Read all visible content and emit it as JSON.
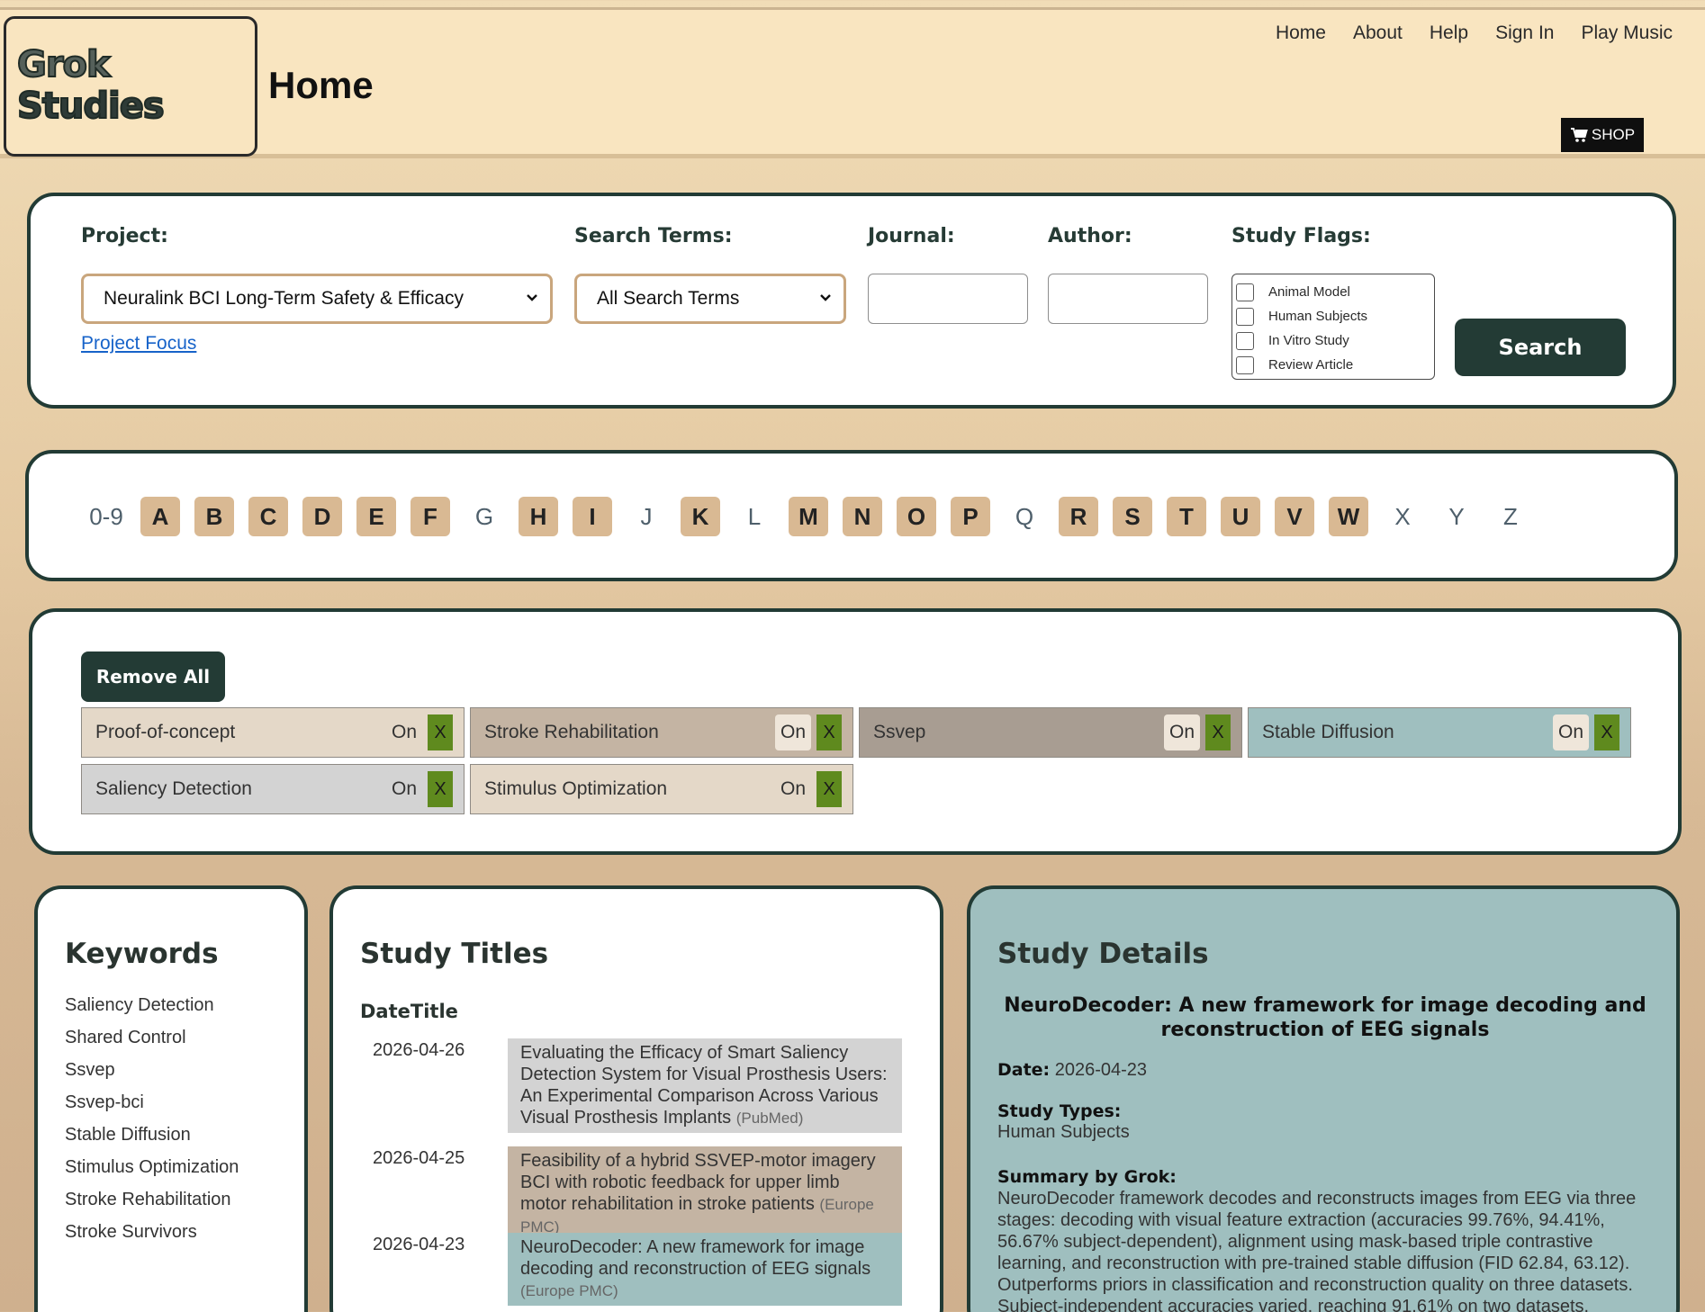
{
  "header": {
    "logo_line1": "Grok",
    "logo_line2": "Studies",
    "title": "Home",
    "nav": [
      "Home",
      "About",
      "Help",
      "Sign In",
      "Play Music"
    ],
    "shop_label": "SHOP"
  },
  "search": {
    "project_label": "Project:",
    "project_value": "Neuralink BCI Long-Term Safety & Efficacy",
    "project_link": "Project Focus",
    "terms_label": "Search Terms:",
    "terms_value": "All Search Terms",
    "journal_label": "Journal:",
    "author_label": "Author:",
    "flags_label": "Study Flags:",
    "flags": [
      "Animal Model",
      "Human Subjects",
      "In Vitro Study",
      "Review Article"
    ],
    "search_button": "Search"
  },
  "alphabet": [
    {
      "l": "0-9",
      "on": false
    },
    {
      "l": "A",
      "on": true
    },
    {
      "l": "B",
      "on": true
    },
    {
      "l": "C",
      "on": true
    },
    {
      "l": "D",
      "on": true
    },
    {
      "l": "E",
      "on": true
    },
    {
      "l": "F",
      "on": true
    },
    {
      "l": "G",
      "on": false
    },
    {
      "l": "H",
      "on": true
    },
    {
      "l": "I",
      "on": true
    },
    {
      "l": "J",
      "on": false
    },
    {
      "l": "K",
      "on": true
    },
    {
      "l": "L",
      "on": false
    },
    {
      "l": "M",
      "on": true
    },
    {
      "l": "N",
      "on": true
    },
    {
      "l": "O",
      "on": true
    },
    {
      "l": "P",
      "on": true
    },
    {
      "l": "Q",
      "on": false
    },
    {
      "l": "R",
      "on": true
    },
    {
      "l": "S",
      "on": true
    },
    {
      "l": "T",
      "on": true
    },
    {
      "l": "U",
      "on": true
    },
    {
      "l": "V",
      "on": true
    },
    {
      "l": "W",
      "on": true
    },
    {
      "l": "X",
      "on": false
    },
    {
      "l": "Y",
      "on": false
    },
    {
      "l": "Z",
      "on": false
    }
  ],
  "filters": {
    "remove_all": "Remove All",
    "on_label": "On",
    "x_label": "X",
    "tags": [
      {
        "label": "Proof-of-concept",
        "color": "#e4d8c8",
        "pill": "#e4d8c8"
      },
      {
        "label": "Stroke Rehabilitation",
        "color": "#c4b4a3",
        "pill": "#efe6da"
      },
      {
        "label": "Ssvep",
        "color": "#a89d92",
        "pill": "#efe6da"
      },
      {
        "label": "Stable Diffusion",
        "color": "#9fbfbf",
        "pill": "#efe6da"
      },
      {
        "label": "Saliency Detection",
        "color": "#d3d3d3",
        "pill": "#d3d3d3"
      },
      {
        "label": "Stimulus Optimization",
        "color": "#e4d8c8",
        "pill": "#e4d8c8"
      }
    ]
  },
  "keywords": {
    "heading": "Keywords",
    "items": [
      "Saliency Detection",
      "Shared Control",
      "Ssvep",
      "Ssvep-bci",
      "Stable Diffusion",
      "Stimulus Optimization",
      "Stroke Rehabilitation",
      "Stroke Survivors"
    ]
  },
  "studies": {
    "heading": "Study Titles",
    "col_header": "DateTitle",
    "rows": [
      {
        "date": "2026-04-26",
        "title": "Evaluating the Efficacy of Smart Saliency Detection System for Visual Prosthesis Users: An Experimental Comparison Across Various Visual Prosthesis Implants",
        "source": "(PubMed)",
        "color": "#d3d3d3"
      },
      {
        "date": "2026-04-25",
        "title": "Feasibility of a hybrid SSVEP-motor imagery BCI with robotic feedback for upper limb motor rehabilitation in stroke patients",
        "source": "(Europe PMC)",
        "color": "#c4b4a3"
      },
      {
        "date": "2026-04-23",
        "title": "NeuroDecoder: A new framework for image decoding and reconstruction of EEG signals",
        "source": "(Europe PMC)",
        "color": "#9fbfbf"
      }
    ]
  },
  "details": {
    "heading": "Study Details",
    "title": "NeuroDecoder: A new framework for image decoding and reconstruction of EEG signals",
    "date_label": "Date:",
    "date": "2026-04-23",
    "types_label": "Study Types:",
    "types": "Human Subjects",
    "summary_label": "Summary by Grok:",
    "summary": "NeuroDecoder framework decodes and reconstructs images from EEG via three stages: decoding with visual feature extraction (accuracies 99.76%, 94.41%, 56.67% subject-dependent), alignment using mask-based triple contrastive learning, and reconstruction with pre-trained stable diffusion (FID 62.84, 63.12). Outperforms priors in classification and reconstruction quality on three datasets. Subject-independent accuracies varied, reaching 91.61% on two datasets."
  }
}
